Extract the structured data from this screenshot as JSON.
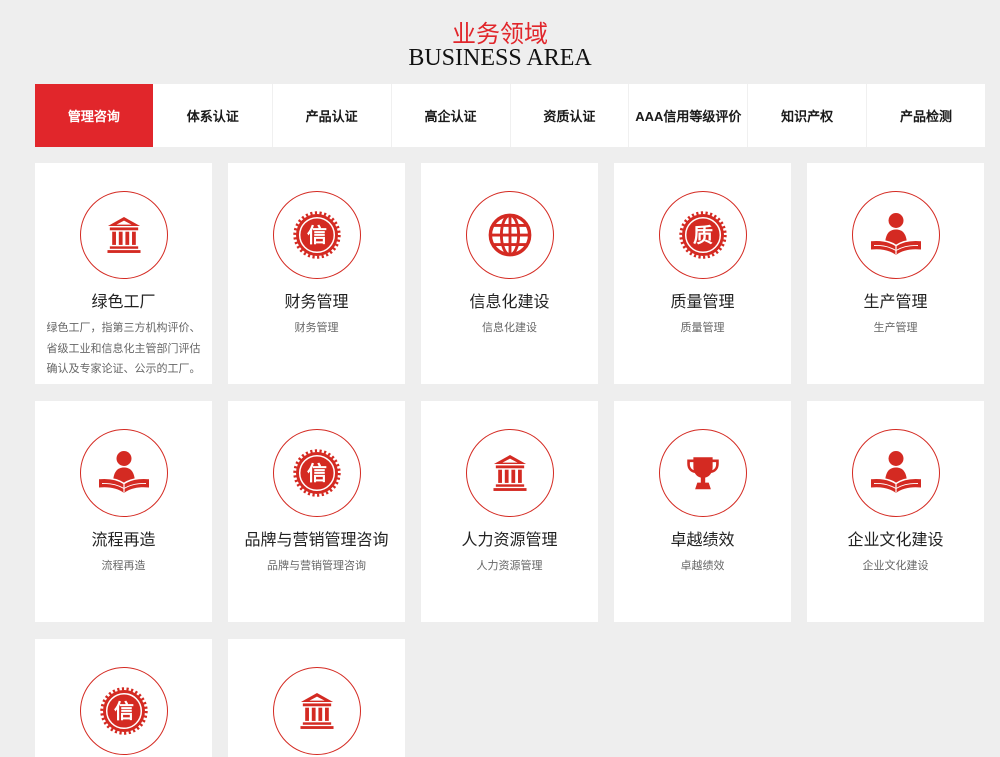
{
  "header": {
    "title_cn": "业务领域",
    "title_en": "BUSINESS AREA"
  },
  "tabs": [
    {
      "label": "管理咨询",
      "active": true
    },
    {
      "label": "体系认证",
      "active": false
    },
    {
      "label": "产品认证",
      "active": false
    },
    {
      "label": "高企认证",
      "active": false
    },
    {
      "label": "资质认证",
      "active": false
    },
    {
      "label": "AAA信用等级评价",
      "active": false
    },
    {
      "label": "知识产权",
      "active": false
    },
    {
      "label": "产品检测",
      "active": false
    }
  ],
  "cards": [
    {
      "icon": "bank-icon",
      "title": "绿色工厂",
      "desc": "绿色工厂，指第三方机构评价、省级工业和信息化主管部门评估确认及专家论证、公示的工厂。"
    },
    {
      "icon": "credit-seal-icon",
      "seal_text": "信",
      "title": "财务管理",
      "desc": "财务管理"
    },
    {
      "icon": "globe-icon",
      "title": "信息化建设",
      "desc": "信息化建设"
    },
    {
      "icon": "quality-seal-icon",
      "seal_text": "质",
      "title": "质量管理",
      "desc": "质量管理"
    },
    {
      "icon": "reader-icon",
      "title": "生产管理",
      "desc": "生产管理"
    },
    {
      "icon": "reader-icon",
      "title": "流程再造",
      "desc": "流程再造"
    },
    {
      "icon": "credit-seal-icon",
      "seal_text": "信",
      "title": "品牌与营销管理咨询",
      "desc": "品牌与营销管理咨询"
    },
    {
      "icon": "bank-icon",
      "title": "人力资源管理",
      "desc": "人力资源管理"
    },
    {
      "icon": "trophy-icon",
      "title": "卓越绩效",
      "desc": "卓越绩效"
    },
    {
      "icon": "reader-icon",
      "title": "企业文化建设",
      "desc": "企业文化建设"
    },
    {
      "icon": "credit-seal-icon",
      "seal_text": "信"
    },
    {
      "icon": "bank-icon"
    }
  ],
  "colors": {
    "accent": "#e1262b",
    "icon": "#d42a22",
    "background": "#eeeeee",
    "card": "#ffffff",
    "text": "#222222",
    "muted": "#666666"
  }
}
